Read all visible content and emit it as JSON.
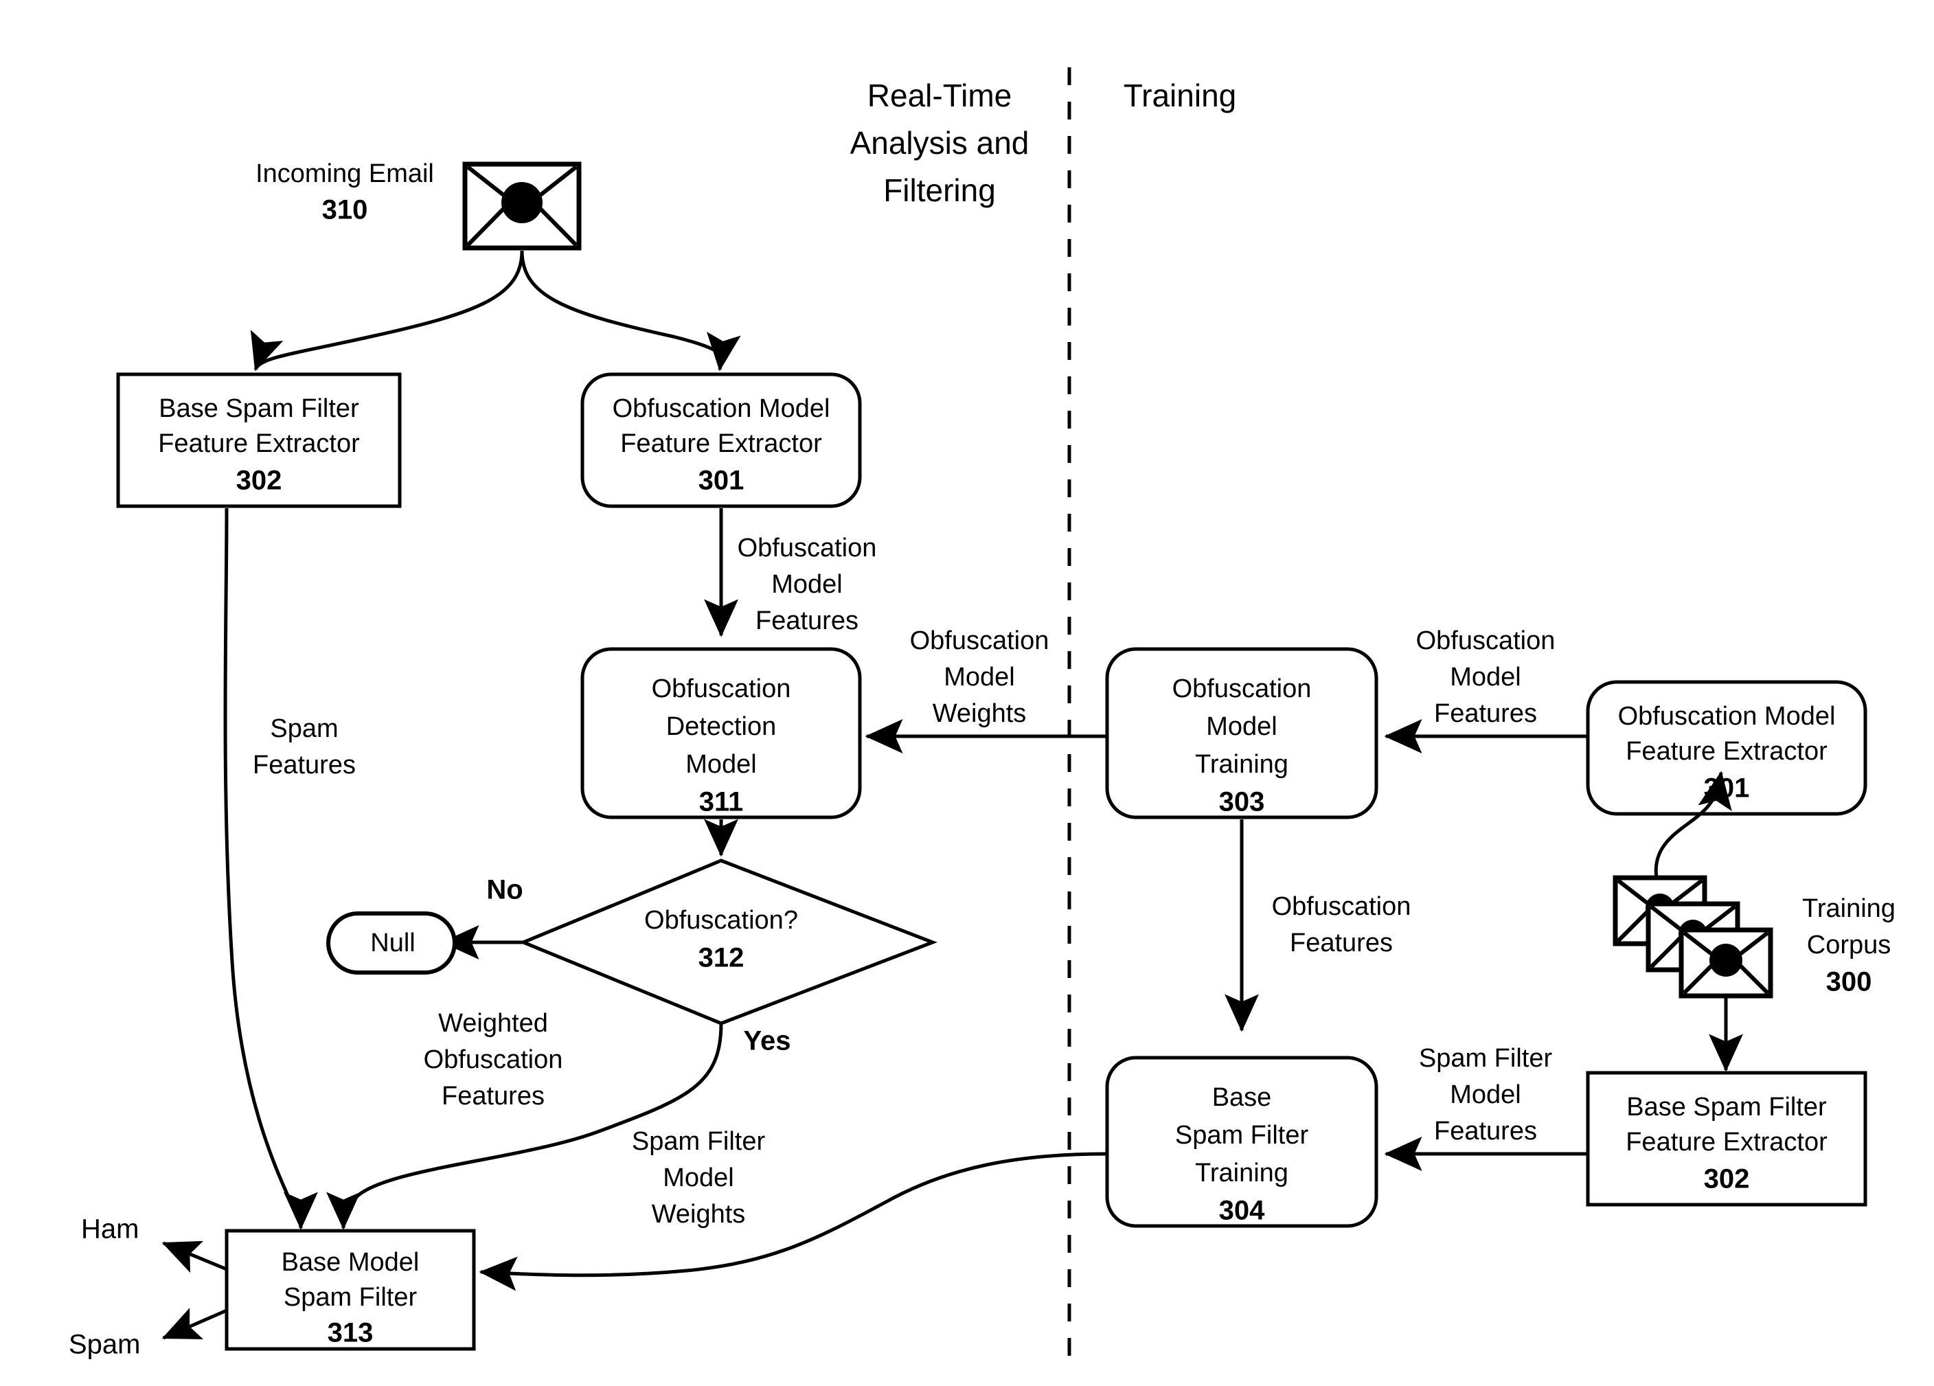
{
  "figure": {
    "sections": [
      {
        "id": "realtime",
        "label": "Real-Time\nAnalysis and\nFiltering",
        "line1": "Real-Time",
        "line2": "Analysis and",
        "line3": "Filtering"
      },
      {
        "id": "training",
        "label": "Training",
        "line1": "Training"
      }
    ],
    "divider": {
      "name": "section-divider",
      "style": "dashed-vertical"
    }
  },
  "nodes": {
    "incoming_email": {
      "label": "Incoming Email",
      "ref": "310",
      "shape": "envelope",
      "icon": "envelope-icon"
    },
    "base_spam_filter_feature_extractor_rt": {
      "line1": "Base Spam Filter",
      "line2": "Feature Extractor",
      "ref": "302",
      "shape": "rectangle"
    },
    "obfuscation_model_feature_extractor_rt": {
      "line1": "Obfuscation Model",
      "line2": "Feature Extractor",
      "ref": "301",
      "shape": "rounded-rectangle"
    },
    "obfuscation_detection_model": {
      "line1": "Obfuscation",
      "line2": "Detection",
      "line3": "Model",
      "ref": "311",
      "shape": "rounded-rectangle"
    },
    "obfuscation_decision": {
      "line1": "Obfuscation?",
      "ref": "312",
      "shape": "diamond"
    },
    "null_terminator": {
      "label": "Null",
      "shape": "pill"
    },
    "base_model_spam_filter": {
      "line1": "Base Model",
      "line2": "Spam Filter",
      "ref": "313",
      "shape": "rectangle"
    },
    "obfuscation_model_training": {
      "line1": "Obfuscation",
      "line2": "Model",
      "line3": "Training",
      "ref": "303",
      "shape": "rounded-rectangle"
    },
    "obfuscation_model_feature_extractor_tr": {
      "line1": "Obfuscation Model",
      "line2": "Feature Extractor",
      "ref": "301",
      "shape": "rounded-rectangle"
    },
    "base_spam_filter_training": {
      "line1": "Base",
      "line2": "Spam Filter",
      "line3": "Training",
      "ref": "304",
      "shape": "rounded-rectangle"
    },
    "base_spam_filter_feature_extractor_tr": {
      "line1": "Base Spam Filter",
      "line2": "Feature Extractor",
      "ref": "302",
      "shape": "rectangle"
    },
    "training_corpus": {
      "line1": "Training",
      "line2": "Corpus",
      "ref": "300",
      "shape": "envelope-stack",
      "icon": "envelope-stack-icon"
    }
  },
  "edge_labels": {
    "obfuscation_model_features_rt": {
      "line1": "Obfuscation",
      "line2": "Model",
      "line3": "Features"
    },
    "spam_features": {
      "line1": "Spam",
      "line2": "Features"
    },
    "obfuscation_model_weights": {
      "line1": "Obfuscation",
      "line2": "Model",
      "line3": "Weights"
    },
    "obfuscation_model_features_tr": {
      "line1": "Obfuscation",
      "line2": "Model",
      "line3": "Features"
    },
    "obfuscation_features": {
      "line1": "Obfuscation",
      "line2": "Features"
    },
    "spam_filter_model_features": {
      "line1": "Spam Filter",
      "line2": "Model",
      "line3": "Features"
    },
    "weighted_obfuscation_features": {
      "line1": "Weighted",
      "line2": "Obfuscation",
      "line3": "Features"
    },
    "spam_filter_model_weights": {
      "line1": "Spam Filter",
      "line2": "Model",
      "line3": "Weights"
    }
  },
  "branch_labels": {
    "no": "No",
    "yes": "Yes"
  },
  "outputs": {
    "ham": "Ham",
    "spam": "Spam"
  },
  "colors": {
    "stroke": "#000000",
    "fill": "#ffffff",
    "background": "#ffffff"
  }
}
